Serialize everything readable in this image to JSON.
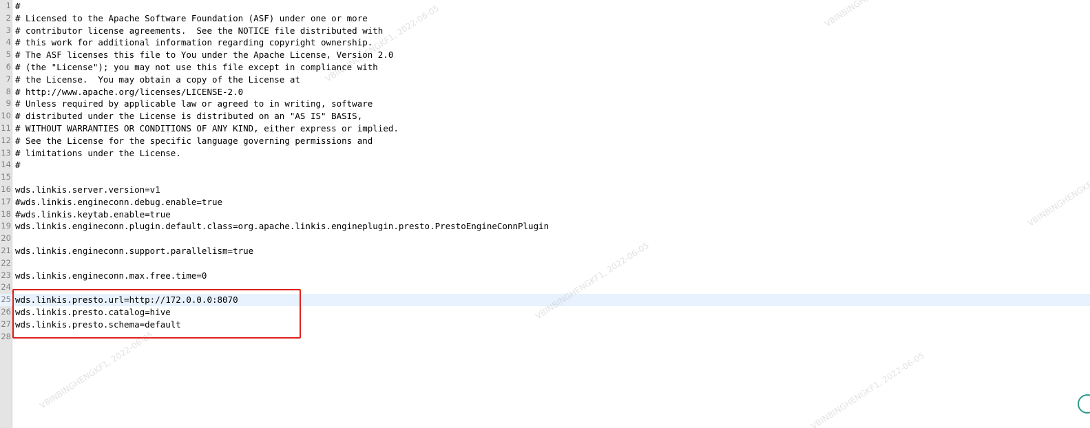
{
  "editor": {
    "current_line": 25,
    "lines": [
      {
        "n": "1",
        "text": "#"
      },
      {
        "n": "2",
        "text": "# Licensed to the Apache Software Foundation (ASF) under one or more"
      },
      {
        "n": "3",
        "text": "# contributor license agreements.  See the NOTICE file distributed with"
      },
      {
        "n": "4",
        "text": "# this work for additional information regarding copyright ownership."
      },
      {
        "n": "5",
        "text": "# The ASF licenses this file to You under the Apache License, Version 2.0"
      },
      {
        "n": "6",
        "text": "# (the \"License\"); you may not use this file except in compliance with"
      },
      {
        "n": "7",
        "text": "# the License.  You may obtain a copy of the License at"
      },
      {
        "n": "8",
        "text": "# http://www.apache.org/licenses/LICENSE-2.0"
      },
      {
        "n": "9",
        "text": "# Unless required by applicable law or agreed to in writing, software"
      },
      {
        "n": "10",
        "text": "# distributed under the License is distributed on an \"AS IS\" BASIS,"
      },
      {
        "n": "11",
        "text": "# WITHOUT WARRANTIES OR CONDITIONS OF ANY KIND, either express or implied."
      },
      {
        "n": "12",
        "text": "# See the License for the specific language governing permissions and"
      },
      {
        "n": "13",
        "text": "# limitations under the License."
      },
      {
        "n": "14",
        "text": "#"
      },
      {
        "n": "15",
        "text": ""
      },
      {
        "n": "16",
        "text": "wds.linkis.server.version=v1"
      },
      {
        "n": "17",
        "text": "#wds.linkis.engineconn.debug.enable=true"
      },
      {
        "n": "18",
        "text": "#wds.linkis.keytab.enable=true"
      },
      {
        "n": "19",
        "text": "wds.linkis.engineconn.plugin.default.class=org.apache.linkis.engineplugin.presto.PrestoEngineConnPlugin"
      },
      {
        "n": "20",
        "text": ""
      },
      {
        "n": "21",
        "text": "wds.linkis.engineconn.support.parallelism=true"
      },
      {
        "n": "22",
        "text": ""
      },
      {
        "n": "23",
        "text": "wds.linkis.engineconn.max.free.time=0"
      },
      {
        "n": "24",
        "text": ""
      },
      {
        "n": "25",
        "text": "wds.linkis.presto.url=http://172.0.0.0:8070"
      },
      {
        "n": "26",
        "text": "wds.linkis.presto.catalog=hive"
      },
      {
        "n": "27",
        "text": "wds.linkis.presto.schema=default"
      },
      {
        "n": "28",
        "text": ""
      }
    ]
  },
  "watermark": {
    "text": "VBINBINGHENGKF1, 2022-06-05"
  },
  "colors": {
    "highlight_box": "#e0201a",
    "current_line_bg": "#e8f2fe",
    "gutter_bg": "#e4e4e4"
  }
}
